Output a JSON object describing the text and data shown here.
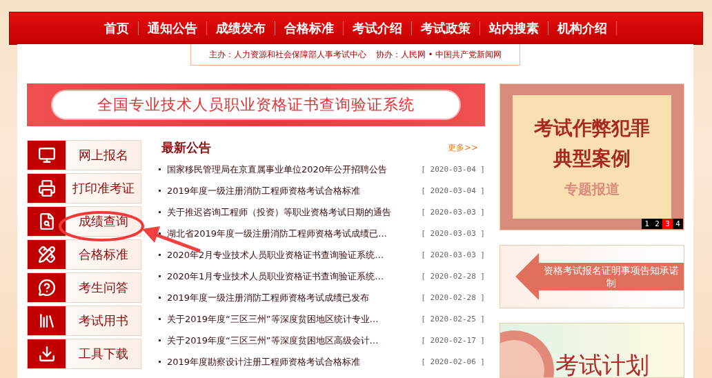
{
  "nav": {
    "items": [
      {
        "label": "首页"
      },
      {
        "label": "通知公告"
      },
      {
        "label": "成绩发布"
      },
      {
        "label": "合格标准"
      },
      {
        "label": "考试介绍"
      },
      {
        "label": "考试政策"
      },
      {
        "label": "站内搜素"
      },
      {
        "label": "机构介绍"
      }
    ]
  },
  "credits": {
    "host": "主办：人力资源和社会保障部人事考试中心",
    "partner": "协办：人民网 • 中国共产党新闻网"
  },
  "banner": {
    "title": "全国专业技术人员职业资格证书查询验证系统"
  },
  "sidebar": {
    "items": [
      {
        "label": "网上报名"
      },
      {
        "label": "打印准考证"
      },
      {
        "label": "成绩查询"
      },
      {
        "label": "合格标准"
      },
      {
        "label": "考生问答"
      },
      {
        "label": "考试用书"
      },
      {
        "label": "工具下载"
      }
    ]
  },
  "news": {
    "title": "最新公告",
    "more": "更多>>",
    "rows": [
      {
        "title": "国家移民管理局在京直属事业单位2020年公开招聘公告",
        "date": "[ 2020-03-04 ]"
      },
      {
        "title": "2019年度一级注册消防工程师资格考试合格标准",
        "date": "[ 2020-03-04 ]"
      },
      {
        "title": "关于推迟咨询工程师（投资）等职业资格考试日期的通告",
        "date": "[ 2020-03-03 ]"
      },
      {
        "title": "湖北省2019年度一级注册消防工程师资格考试成绩已…",
        "date": "[ 2020-03-03 ]"
      },
      {
        "title": "2020年2月专业技术人员职业资格证书查询验证系统…",
        "date": "[ 2020-03-03 ]"
      },
      {
        "title": "2020年1月专业技术人员职业资格证书查询验证系统…",
        "date": "[ 2020-02-28 ]"
      },
      {
        "title": "2019年度一级注册消防工程师资格考试成绩已发布",
        "date": "[ 2020-02-28 ]"
      },
      {
        "title": "关于2019年度“三区三州”等深度贫困地区统计专业…",
        "date": "[ 2020-02-25 ]"
      },
      {
        "title": "关于2019年度“三区三州”等深度贫困地区高级会计…",
        "date": "[ 2020-02-17 ]"
      },
      {
        "title": "2019年度勘察设计注册工程师资格考试合格标准",
        "date": "[ 2020-02-06 ]"
      }
    ]
  },
  "promo": {
    "line1": "考试作弊犯罪",
    "line2": "典型案例",
    "line3": "专题报道",
    "pages": [
      {
        "label": "1",
        "selected": false
      },
      {
        "label": "2",
        "selected": false
      },
      {
        "label": "3",
        "selected": true
      },
      {
        "label": "4",
        "selected": false
      }
    ]
  },
  "notice_banner": {
    "text": "资格考试报名证明事项告知承诺制"
  },
  "plan_banner": {
    "text": "考试计划"
  }
}
